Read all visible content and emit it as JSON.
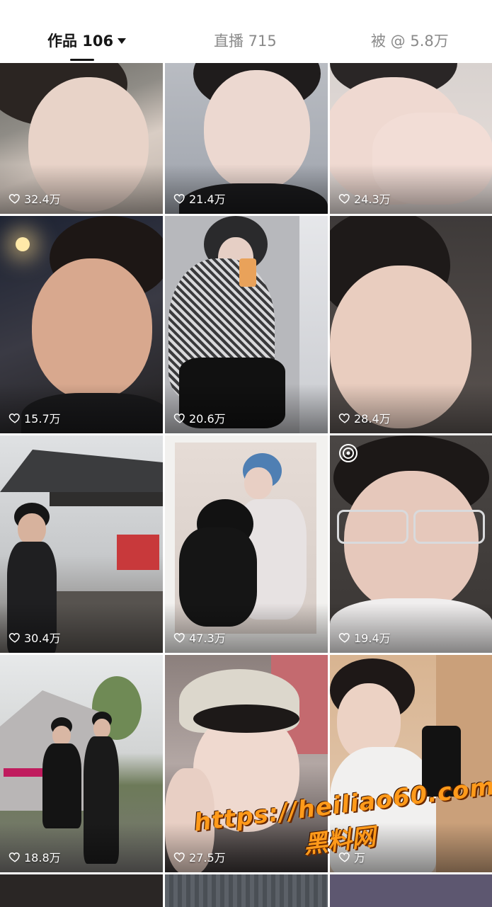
{
  "tabs": {
    "works_label": "作品 106",
    "live_label": "直播 715",
    "mention_label": "被 @ 5.8万"
  },
  "icons": {
    "like": "heart-outline-icon",
    "live": "live-broadcast-icon",
    "dropdown": "caret-down-icon"
  },
  "posts": [
    {
      "likes": "32.4万"
    },
    {
      "likes": "21.4万"
    },
    {
      "likes": "24.3万"
    },
    {
      "likes": "15.7万"
    },
    {
      "likes": "20.6万"
    },
    {
      "likes": "28.4万"
    },
    {
      "likes": "30.4万"
    },
    {
      "likes": "47.3万"
    },
    {
      "likes": "19.4万",
      "live": true
    },
    {
      "likes": "18.8万"
    },
    {
      "likes": "27.5万"
    },
    {
      "likes": "万"
    }
  ],
  "watermark": {
    "url": "https://heiliao60.com",
    "name": "黑料网"
  },
  "colors": {
    "active_tab": "#161616",
    "inactive_tab": "#8a8a8a",
    "watermark": "#ff9a1a"
  }
}
